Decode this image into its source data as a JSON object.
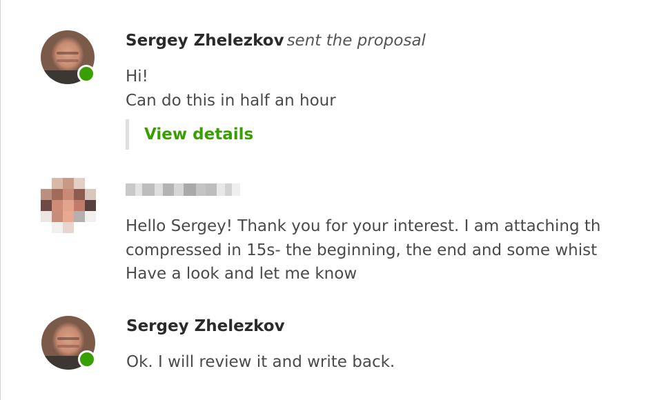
{
  "messages": [
    {
      "sender": "Sergey Zhelezkov",
      "action": "sent the proposal",
      "online": true,
      "lines": [
        "Hi!",
        "Can do this in half an hour"
      ],
      "link": "View details"
    },
    {
      "sender": "",
      "sender_redacted": true,
      "online": false,
      "lines": [
        "Hello Sergey! Thank you for your interest. I am attaching th",
        "compressed in 15s- the beginning, the end and some whist",
        "Have a look and let me know"
      ]
    },
    {
      "sender": "Sergey Zhelezkov",
      "online": true,
      "lines": [
        "Ok. I will review it and write back."
      ]
    }
  ],
  "colors": {
    "link": "#37a000",
    "online": "#37a000",
    "sender": "#2b2b2b",
    "text": "#4a4a4a",
    "quote_bar": "#e0e0e0"
  },
  "icons": {
    "online_indicator": "online-status-icon"
  }
}
